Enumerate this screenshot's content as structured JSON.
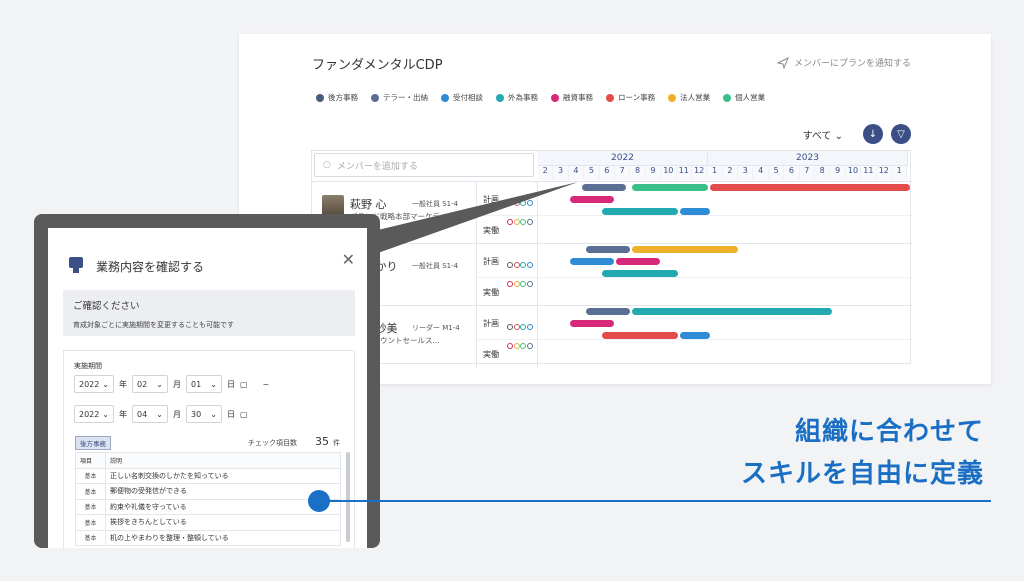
{
  "main": {
    "title": "ファンダメンタルCDP",
    "notify_label": "メンバーにプランを通知する",
    "filter_label": "すべて",
    "search_placeholder": "メンバーを追加する",
    "legend": [
      {
        "label": "後方事務",
        "color": "#4a5d7e"
      },
      {
        "label": "テラー・出納",
        "color": "#5b6f94"
      },
      {
        "label": "受付相談",
        "color": "#2e8bd6"
      },
      {
        "label": "外為事務",
        "color": "#23a9b0"
      },
      {
        "label": "融資事務",
        "color": "#d8287a"
      },
      {
        "label": "ローン事務",
        "color": "#e44c4c"
      },
      {
        "label": "法人営業",
        "color": "#f0b12a"
      },
      {
        "label": "個人営業",
        "color": "#3bbf8a"
      }
    ],
    "years": [
      "2022",
      "2023"
    ],
    "months": [
      "2",
      "3",
      "4",
      "5",
      "6",
      "7",
      "8",
      "9",
      "10",
      "11",
      "12",
      "1",
      "2",
      "3",
      "4",
      "5",
      "6",
      "7",
      "8",
      "9",
      "10",
      "11",
      "12",
      "1"
    ],
    "plan_label": "計画",
    "actual_label": "実働",
    "members": [
      {
        "name": "萩野 心",
        "role": "一般社員 S1-4",
        "dept": "ブランド戦略本部マーケティ..."
      },
      {
        "name": "原 ゆかり",
        "role": "一般社員 S1-4",
        "dept": "部"
      },
      {
        "name": "藤 亜紗美",
        "role": "リーダー M1-4",
        "dept": "本部アカウントセールス..."
      }
    ]
  },
  "modal": {
    "title": "業務内容を確認する",
    "notice_heading": "ご確認ください",
    "notice_text": "育成対象ごとに実施期間を変更することも可能です",
    "period_label": "実施期間",
    "start": {
      "year": "2022",
      "month": "02",
      "day": "01"
    },
    "end": {
      "year": "2022",
      "month": "04",
      "day": "30"
    },
    "unit_year": "年",
    "unit_month": "月",
    "unit_day": "日",
    "range_sep": "~",
    "tag": "後方事務",
    "count_label": "チェック項目数",
    "count": "35",
    "count_unit": "件",
    "table_headers": [
      "項目",
      "説明"
    ],
    "rows": [
      {
        "cat": "基本",
        "desc": "正しい名刺交換のしかたを知っている"
      },
      {
        "cat": "基本",
        "desc": "郵便物の受発信ができる"
      },
      {
        "cat": "基本",
        "desc": "約束や礼儀を守っている"
      },
      {
        "cat": "基本",
        "desc": "挨拶をきちんとしている"
      },
      {
        "cat": "基本",
        "desc": "机の上やまわりを整理・整頓している"
      }
    ]
  },
  "headline": {
    "line1": "組織に合わせて",
    "line2": "スキルを自由に定義"
  }
}
